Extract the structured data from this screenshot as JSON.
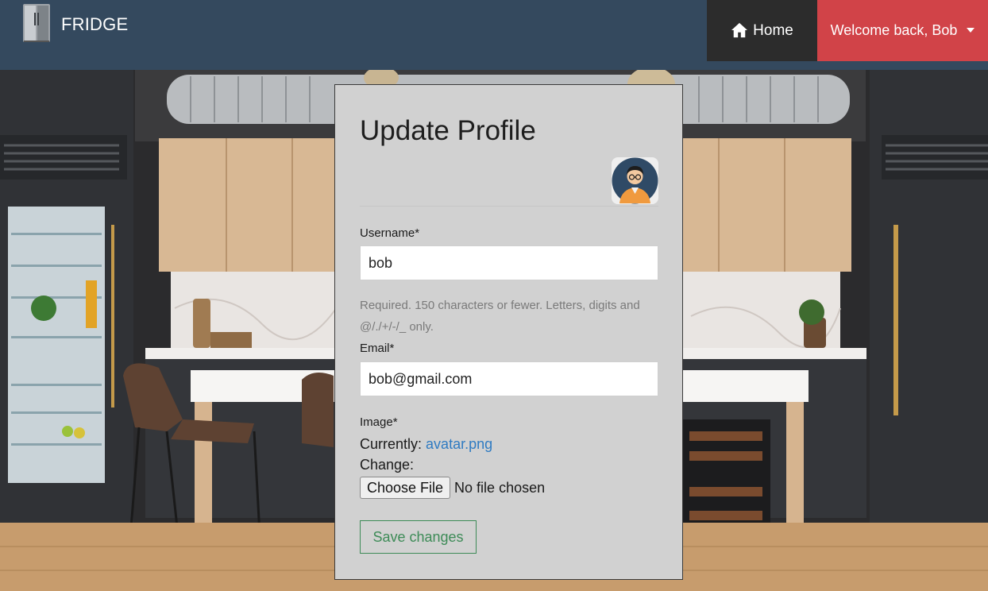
{
  "navbar": {
    "brand": "FRIDGE",
    "home_label": "Home",
    "user_menu_label": "Welcome back, Bob"
  },
  "form": {
    "title": "Update Profile",
    "username": {
      "label": "Username*",
      "value": "bob",
      "help": "Required. 150 characters or fewer. Letters, digits and @/./+/-/_ only."
    },
    "email": {
      "label": "Email*",
      "value": "bob@gmail.com"
    },
    "image": {
      "label": "Image*",
      "currently_label": "Currently:",
      "current_file": "avatar.png",
      "change_label": "Change:",
      "choose_file_label": "Choose File",
      "no_file_text": "No file chosen"
    },
    "submit_label": "Save changes"
  },
  "colors": {
    "navbar_bg": "#34495e",
    "home_bg": "#2c2c2c",
    "user_menu_bg": "#d14348",
    "card_bg": "#d1d1d1",
    "link": "#2f7bc2",
    "save_button": "#3d8b57"
  },
  "icons": {
    "brand": "fridge-icon",
    "home": "home-icon",
    "user_menu": "caret-down-icon",
    "avatar": "user-avatar"
  }
}
